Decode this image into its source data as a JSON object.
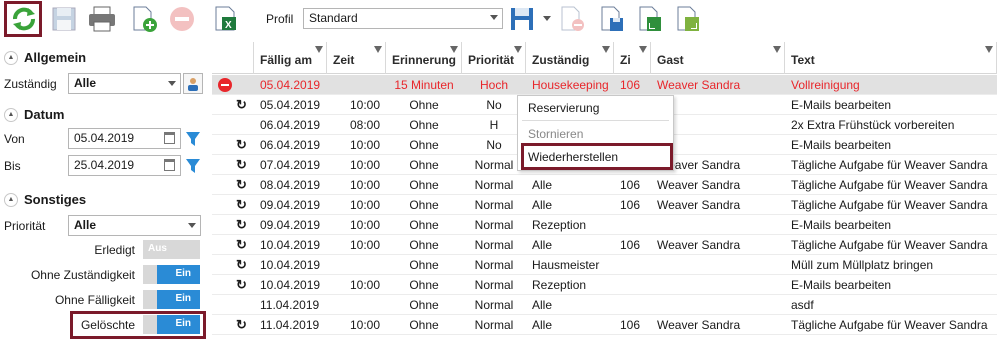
{
  "toolbar": {
    "profil_label": "Profil",
    "profil_value": "Standard"
  },
  "left": {
    "allgemein": {
      "title": "Allgemein",
      "zustaendig_label": "Zuständig",
      "zustaendig_value": "Alle"
    },
    "datum": {
      "title": "Datum",
      "von_label": "Von",
      "von_value": "05.04.2019",
      "bis_label": "Bis",
      "bis_value": "25.04.2019"
    },
    "sonstiges": {
      "title": "Sonstiges",
      "prioritaet_label": "Priorität",
      "prioritaet_value": "Alle",
      "toggles": [
        {
          "label": "Erledigt",
          "state": "Aus",
          "on": false
        },
        {
          "label": "Ohne Zuständigkeit",
          "state": "Ein",
          "on": true
        },
        {
          "label": "Ohne Fälligkeit",
          "state": "Ein",
          "on": true
        },
        {
          "label": "Gelöschte",
          "state": "Ein",
          "on": true
        }
      ]
    }
  },
  "grid": {
    "columns": [
      "Fällig am",
      "Zeit",
      "Erinnerung",
      "Priorität",
      "Zuständig",
      "Zi",
      "Gast",
      "Text"
    ],
    "rows": [
      {
        "deleted": true,
        "repeat": false,
        "date": "05.04.2019",
        "time": "",
        "reminder": "15 Minuten",
        "priority": "Hoch",
        "assignee": "Housekeeping",
        "room": "106",
        "guest": "Weaver Sandra",
        "text": "Vollreinigung"
      },
      {
        "deleted": false,
        "repeat": true,
        "date": "05.04.2019",
        "time": "10:00",
        "reminder": "Ohne",
        "priority": "No",
        "assignee": "",
        "room": "",
        "guest": "",
        "text": "E-Mails bearbeiten"
      },
      {
        "deleted": false,
        "repeat": false,
        "date": "06.04.2019",
        "time": "08:00",
        "reminder": "Ohne",
        "priority": "H",
        "assignee": "",
        "room": "",
        "guest": "",
        "text": "2x Extra Frühstück vorbereiten"
      },
      {
        "deleted": false,
        "repeat": true,
        "date": "06.04.2019",
        "time": "10:00",
        "reminder": "Ohne",
        "priority": "No",
        "assignee": "",
        "room": "",
        "guest": "",
        "text": "E-Mails bearbeiten"
      },
      {
        "deleted": false,
        "repeat": true,
        "date": "07.04.2019",
        "time": "10:00",
        "reminder": "Ohne",
        "priority": "Normal",
        "assignee": "",
        "room": "",
        "guest": "Weaver Sandra",
        "text": "Tägliche Aufgabe für Weaver Sandra"
      },
      {
        "deleted": false,
        "repeat": true,
        "date": "08.04.2019",
        "time": "10:00",
        "reminder": "Ohne",
        "priority": "Normal",
        "assignee": "Alle",
        "room": "106",
        "guest": "Weaver Sandra",
        "text": "Tägliche Aufgabe für Weaver Sandra"
      },
      {
        "deleted": false,
        "repeat": true,
        "date": "09.04.2019",
        "time": "10:00",
        "reminder": "Ohne",
        "priority": "Normal",
        "assignee": "Alle",
        "room": "106",
        "guest": "Weaver Sandra",
        "text": "Tägliche Aufgabe für Weaver Sandra"
      },
      {
        "deleted": false,
        "repeat": true,
        "date": "09.04.2019",
        "time": "10:00",
        "reminder": "Ohne",
        "priority": "Normal",
        "assignee": "Rezeption",
        "room": "",
        "guest": "",
        "text": "E-Mails bearbeiten"
      },
      {
        "deleted": false,
        "repeat": true,
        "date": "10.04.2019",
        "time": "10:00",
        "reminder": "Ohne",
        "priority": "Normal",
        "assignee": "Alle",
        "room": "106",
        "guest": "Weaver Sandra",
        "text": "Tägliche Aufgabe für Weaver Sandra"
      },
      {
        "deleted": false,
        "repeat": true,
        "date": "10.04.2019",
        "time": "",
        "reminder": "Ohne",
        "priority": "Normal",
        "assignee": "Hausmeister",
        "room": "",
        "guest": "",
        "text": "Müll zum Müllplatz bringen"
      },
      {
        "deleted": false,
        "repeat": true,
        "date": "10.04.2019",
        "time": "10:00",
        "reminder": "Ohne",
        "priority": "Normal",
        "assignee": "Rezeption",
        "room": "",
        "guest": "",
        "text": "E-Mails bearbeiten"
      },
      {
        "deleted": false,
        "repeat": false,
        "date": "11.04.2019",
        "time": "",
        "reminder": "Ohne",
        "priority": "Normal",
        "assignee": "Alle",
        "room": "",
        "guest": "",
        "text": "asdf"
      },
      {
        "deleted": false,
        "repeat": true,
        "date": "11.04.2019",
        "time": "10:00",
        "reminder": "Ohne",
        "priority": "Normal",
        "assignee": "Alle",
        "room": "106",
        "guest": "Weaver Sandra",
        "text": "Tägliche Aufgabe für Weaver Sandra"
      }
    ]
  },
  "context_menu": {
    "items": [
      "Reservierung",
      "Stornieren",
      "Wiederherstellen"
    ]
  },
  "icons": {
    "refresh": "refresh-icon",
    "save": "save-icon",
    "print": "print-icon",
    "new": "new-document-icon",
    "delete": "delete-icon",
    "excel": "excel-export-icon",
    "save_profile": "save-profile-icon"
  },
  "colors": {
    "highlight_border": "#7b1a2a",
    "deleted_text": "#e8262b",
    "toggle_on": "#2a8bd6"
  }
}
